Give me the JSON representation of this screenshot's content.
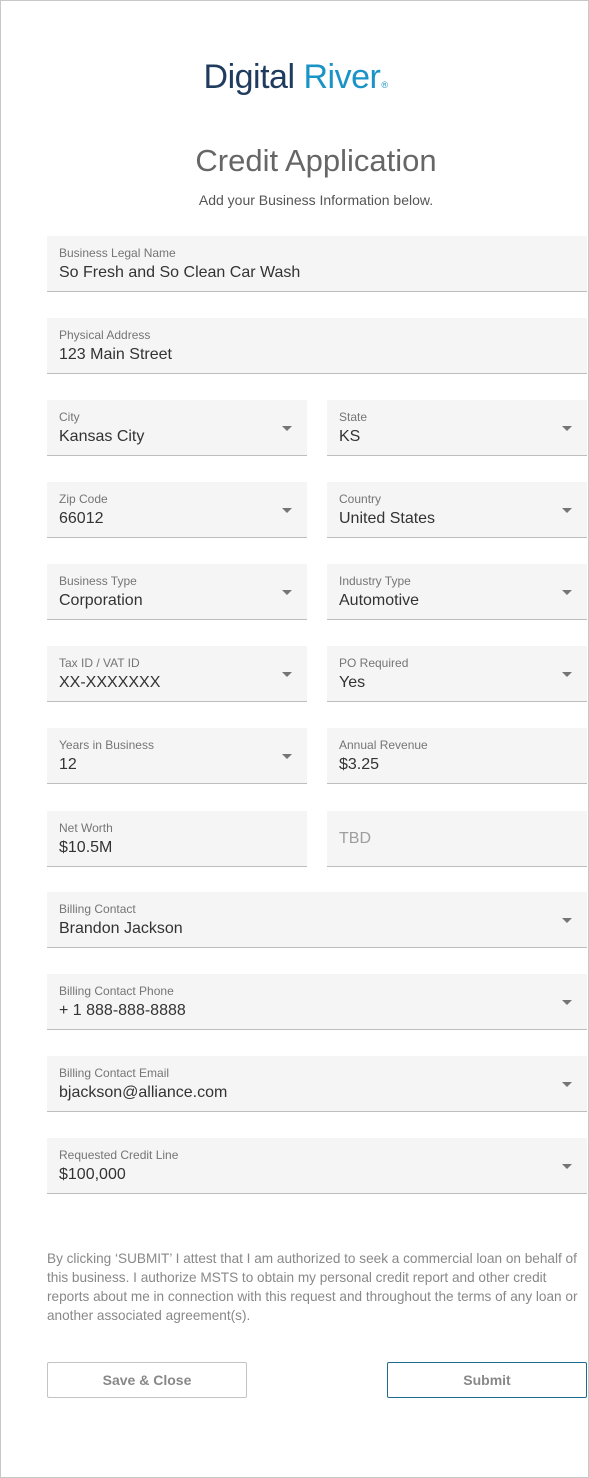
{
  "brand": {
    "word1": "Digital",
    "word2": "River",
    "reg": "®"
  },
  "title": "Credit Application",
  "subtitle": "Add your Business Information below.",
  "fields": {
    "business_legal_name": {
      "label": "Business Legal Name",
      "value": "So Fresh and So Clean Car Wash"
    },
    "physical_address": {
      "label": "Physical Address",
      "value": "123 Main Street"
    },
    "city": {
      "label": "City",
      "value": "Kansas City"
    },
    "state": {
      "label": "State",
      "value": "KS"
    },
    "zip_code": {
      "label": "Zip Code",
      "value": "66012"
    },
    "country": {
      "label": "Country",
      "value": "United States"
    },
    "business_type": {
      "label": "Business Type",
      "value": "Corporation"
    },
    "industry_type": {
      "label": "Industry Type",
      "value": "Automotive"
    },
    "tax_id": {
      "label": "Tax ID / VAT ID",
      "value": "XX-XXXXXXX"
    },
    "po_required": {
      "label": "PO Required",
      "value": "Yes"
    },
    "years_in_business": {
      "label": "Years in Business",
      "value": "12"
    },
    "annual_revenue": {
      "label": "Annual Revenue",
      "value": "$3.25"
    },
    "net_worth": {
      "label": "Net Worth",
      "value": "$10.5M"
    },
    "tbd": {
      "placeholder": "TBD"
    },
    "billing_contact": {
      "label": "Billing Contact",
      "value": "Brandon Jackson"
    },
    "billing_contact_phone": {
      "label": "Billing Contact Phone",
      "value": "+ 1 888-888-8888"
    },
    "billing_contact_email": {
      "label": "Billing Contact Email",
      "value": "bjackson@alliance.com"
    },
    "requested_credit_line": {
      "label": "Requested Credit Line",
      "value": "$100,000"
    }
  },
  "disclaimer": "By clicking ‘SUBMIT’ I attest that I am authorized to seek a commercial loan on behalf of this business. I authorize MSTS to obtain my personal credit report and other credit reports about me in connection with this request and throughout the terms of any loan or another associated agreement(s).",
  "buttons": {
    "save_close": "Save & Close",
    "submit": "Submit"
  },
  "colors": {
    "brand_dark": "#1f3b5e",
    "brand_accent": "#1a94c7",
    "submit_border": "#1d6b8e"
  }
}
